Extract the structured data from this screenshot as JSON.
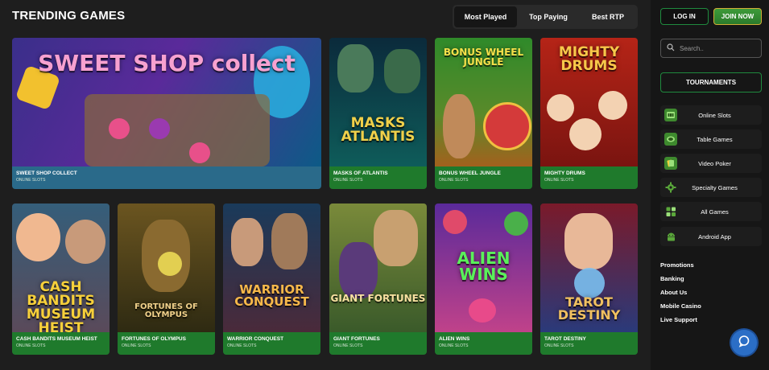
{
  "header": {
    "title": "TRENDING GAMES",
    "tabs": [
      {
        "label": "Most Played",
        "active": true
      },
      {
        "label": "Top Paying",
        "active": false
      },
      {
        "label": "Best RTP",
        "active": false
      }
    ]
  },
  "games": [
    {
      "name": "SWEET SHOP COLLECT",
      "category": "ONLINE SLOTS",
      "logo": "SWEET SHOP collect",
      "bg": "#3a2f8a",
      "bg2": "#0d5a86",
      "footer": "#2a7d2c"
    },
    {
      "name": "MASKS OF ATLANTIS",
      "category": "ONLINE SLOTS",
      "logo": "MASKS ATLANTIS",
      "bg": "#0e5c5a",
      "bg2": "#0b2a3b",
      "footer": "#1f7a2c"
    },
    {
      "name": "BONUS WHEEL JUNGLE",
      "category": "ONLINE SLOTS",
      "logo": "BONUS WHEEL JUNGLE",
      "bg": "#2f8a2a",
      "bg2": "#a3611d",
      "footer": "#1f7a2c"
    },
    {
      "name": "MIGHTY DRUMS",
      "category": "ONLINE SLOTS",
      "logo": "MIGHTY DRUMS",
      "bg": "#b52417",
      "bg2": "#5a0b0b",
      "footer": "#1f7a2c"
    },
    {
      "name": "CASH BANDITS MUSEUM HEIST",
      "category": "ONLINE SLOTS",
      "logo": "CASH BANDITS MUSEUM HEIST",
      "bg": "#355e7a",
      "bg2": "#8a3a2a",
      "footer": "#1f7a2c"
    },
    {
      "name": "FORTUNES OF OLYMPUS",
      "category": "ONLINE SLOTS",
      "logo": "FORTUNES OF OLYMPUS",
      "bg": "#6b5520",
      "bg2": "#2e2a12",
      "footer": "#1f7a2c"
    },
    {
      "name": "WARRIOR CONQUEST",
      "category": "ONLINE SLOTS",
      "logo": "WARRIOR CONQUEST",
      "bg": "#4a2a3a",
      "bg2": "#1a3a5a",
      "footer": "#1f7a2c"
    },
    {
      "name": "GIANT FORTUNES",
      "category": "ONLINE SLOTS",
      "logo": "GIANT FORTUNES",
      "bg": "#7a8a3a",
      "bg2": "#3a5a2a",
      "footer": "#1f7a2c"
    },
    {
      "name": "ALIEN WINS",
      "category": "ONLINE SLOTS",
      "logo": "ALIEN WINS",
      "bg": "#5a2a9a",
      "bg2": "#c0428a",
      "footer": "#1f7a2c"
    },
    {
      "name": "TAROT DESTINY",
      "category": "ONLINE SLOTS",
      "logo": "TAROT DESTINY",
      "bg": "#7a1a2a",
      "bg2": "#2a3a7a",
      "footer": "#1f7a2c"
    }
  ],
  "sidebar": {
    "login_label": "LOG IN",
    "join_label": "JOIN NOW",
    "search_placeholder": "Search..",
    "tournaments_label": "TOURNAMENTS",
    "nav": [
      {
        "label": "Online Slots",
        "icon": "slot-machine-icon",
        "color": "#5aa83a"
      },
      {
        "label": "Table Games",
        "icon": "table-games-icon",
        "color": "#5aa83a"
      },
      {
        "label": "Video Poker",
        "icon": "cards-icon",
        "color": "#5aa83a"
      },
      {
        "label": "Specialty Games",
        "icon": "gear-icon",
        "color": "#5aa83a"
      },
      {
        "label": "All Games",
        "icon": "grid-icon",
        "color": "#5aa83a"
      },
      {
        "label": "Android App",
        "icon": "android-icon",
        "color": "#5aa83a"
      }
    ],
    "links": [
      "Promotions",
      "Banking",
      "About Us",
      "Mobile Casino",
      "Live Support"
    ]
  },
  "colors": {
    "accent_green": "#1f8a3e",
    "gold": "#d2ae37",
    "chat_blue": "#2b6ec6"
  }
}
